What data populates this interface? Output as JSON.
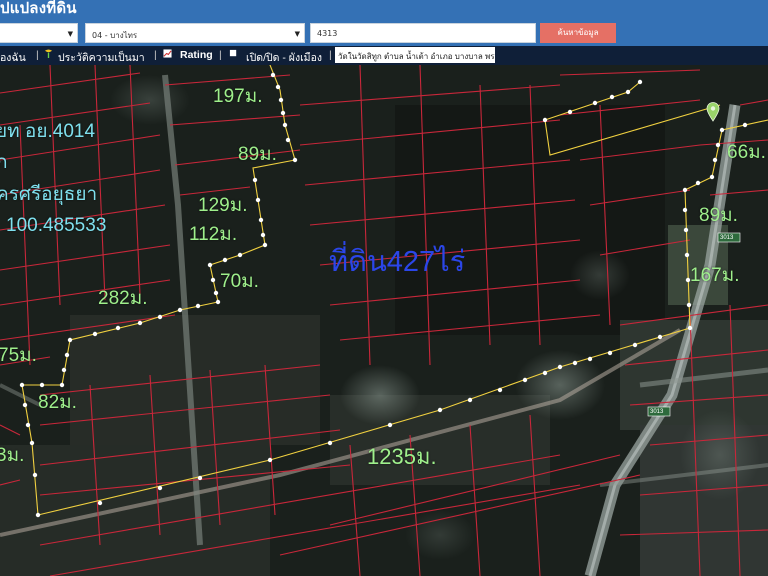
{
  "header": {
    "title": "ปแปลงที่ดิน"
  },
  "search": {
    "province_select": "",
    "district_select": "04 - บางไทร",
    "parcel_number": "4313",
    "search_button": "ค้นหาข้อมูล"
  },
  "toolbar": {
    "item_partial": "องฉัน",
    "history_label": "ประวัติความเป็นมา",
    "rating_label": "Rating",
    "zoning_toggle_label": "เปิด/ปิด - ผังเมือง",
    "address": "วัดในวัดสิทูก ตำบล น้ำเต้า อำเภอ บางบาล พระ"
  },
  "map": {
    "info_lines": [
      "ยท อย.4014",
      "ก",
      "ครศรีอยุธยา",
      "100.485533"
    ],
    "area_label": "ที่ดิน427ไร่",
    "road_tags": [
      "3013",
      "3013"
    ],
    "lengths": [
      {
        "id": "197",
        "text": "197ม."
      },
      {
        "id": "89a",
        "text": "89ม."
      },
      {
        "id": "129",
        "text": "129ม."
      },
      {
        "id": "112",
        "text": "112ม."
      },
      {
        "id": "70",
        "text": "70ม."
      },
      {
        "id": "282",
        "text": "282ม."
      },
      {
        "id": "75",
        "text": "75ม."
      },
      {
        "id": "82",
        "text": "82ม."
      },
      {
        "id": "3x",
        "text": "3ม."
      },
      {
        "id": "66",
        "text": "66ม."
      },
      {
        "id": "89b",
        "text": "89ม."
      },
      {
        "id": "167",
        "text": "167ม."
      },
      {
        "id": "1235",
        "text": "1235ม."
      }
    ]
  },
  "colors": {
    "header_bg": "#3471b5",
    "toolbar_bg": "#0f1f38",
    "parcel_line": "#c8273a",
    "boundary_line": "#f0d040",
    "length_text": "#9ff08c",
    "area_text": "#2b46e8",
    "info_text": "#7fe0ee",
    "search_button": "#e57065"
  },
  "icons": [
    "chevron-down-icon",
    "tree-icon",
    "chart-icon",
    "square-icon",
    "map-pin-icon"
  ]
}
